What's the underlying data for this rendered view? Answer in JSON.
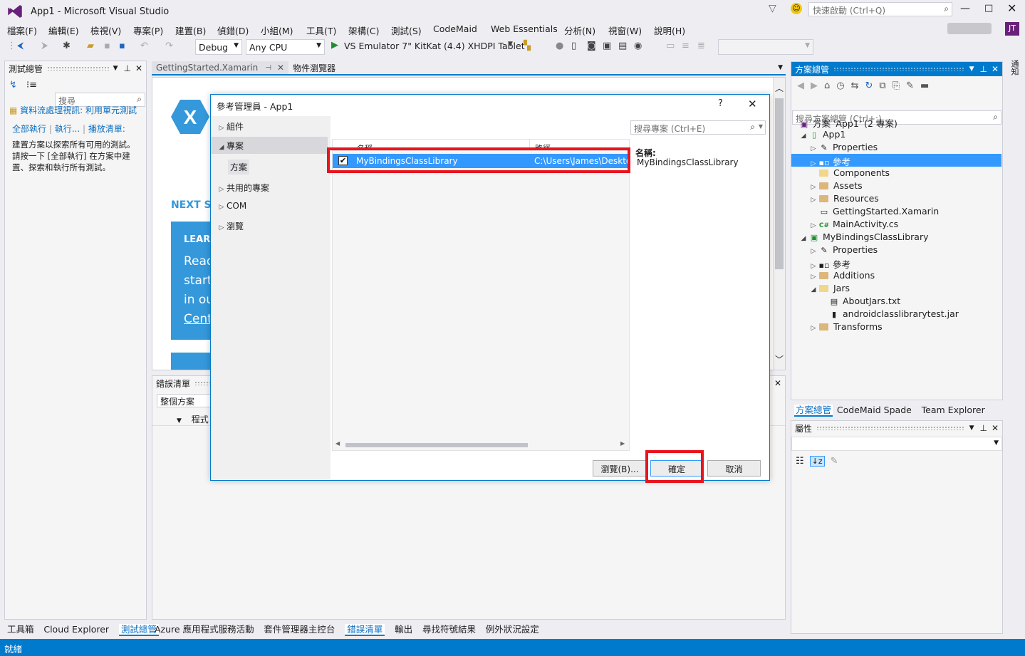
{
  "window": {
    "title": "App1 - Microsoft Visual Studio",
    "quick_launch_placeholder": "快速啟動 (Ctrl+Q)",
    "user_initials": "JT"
  },
  "menu": [
    "檔案(F)",
    "編輯(E)",
    "檢視(V)",
    "專案(P)",
    "建置(B)",
    "偵錯(D)",
    "小組(M)",
    "工具(T)",
    "架構(C)",
    "測試(S)",
    "CodeMaid",
    "Web Essentials",
    "分析(N)",
    "視窗(W)",
    "說明(H)"
  ],
  "toolbar": {
    "config": "Debug",
    "platform": "Any CPU",
    "run_target": "VS Emulator 7\" KitKat (4.4) XHDPI Tablet"
  },
  "test_explorer": {
    "title": "測試總管",
    "search_placeholder": "搜尋",
    "banner": "資料流處理視訊: 利用單元測試",
    "run_all": "全部執行",
    "run": "執行...",
    "playlist": "播放清單:",
    "hint": "建置方案以探索所有可用的測試。請按一下 [全部執行] 在方案中建置、探索和執行所有測試。"
  },
  "doc_tabs": [
    "GettingStarted.Xamarin",
    "物件瀏覽器"
  ],
  "start_page": {
    "next_steps": "NEXT ST",
    "learn": "LEARN",
    "body_lines": [
      "Read",
      "starte",
      "in ou",
      "Cente"
    ]
  },
  "error_list": {
    "title": "錯誤清單",
    "scope": "整個方案",
    "col": "程式"
  },
  "dialog": {
    "title": "參考管理員 - App1",
    "help": "?",
    "nav": {
      "assemblies": "組件",
      "projects": "專案",
      "solution": "方案",
      "shared": "共用的專案",
      "com": "COM",
      "browse": "瀏覽"
    },
    "search_placeholder": "搜尋專案 (Ctrl+E)",
    "col_name": "名稱",
    "col_path": "路徑",
    "row": {
      "name": "MyBindingsClassLibrary",
      "path": "C:\\Users\\James\\Desktop"
    },
    "detail_label": "名稱:",
    "detail_value": "MyBindingsClassLibrary",
    "browse_button": "瀏覽(B)...",
    "ok_button": "確定",
    "cancel_button": "取消"
  },
  "solution_explorer": {
    "title": "方案總管",
    "search_placeholder": "搜尋方案總管 (Ctrl+;)",
    "items": [
      "方案 'App1' (2 專案)",
      "App1",
      "Properties",
      "參考",
      "Components",
      "Assets",
      "Resources",
      "GettingStarted.Xamarin",
      "MainActivity.cs",
      "MyBindingsClassLibrary",
      "Properties",
      "參考",
      "Additions",
      "Jars",
      "AboutJars.txt",
      "androidclasslibrarytest.jar",
      "Transforms"
    ],
    "tabs": [
      "方案總管",
      "CodeMaid Spade",
      "Team Explorer"
    ]
  },
  "properties": {
    "title": "屬性"
  },
  "left_bottom_tabs": [
    "工具箱",
    "Cloud Explorer",
    "測試總管"
  ],
  "center_bottom_tabs": [
    "Azure 應用程式服務活動",
    "套件管理器主控台",
    "錯誤清單",
    "輸出",
    "尋找符號結果",
    "例外狀況設定"
  ],
  "right_strip": "通知",
  "status": "就緒",
  "colors": {
    "accent": "#007acc",
    "selection": "#3399ff",
    "highlight_box": "#e8141e"
  }
}
